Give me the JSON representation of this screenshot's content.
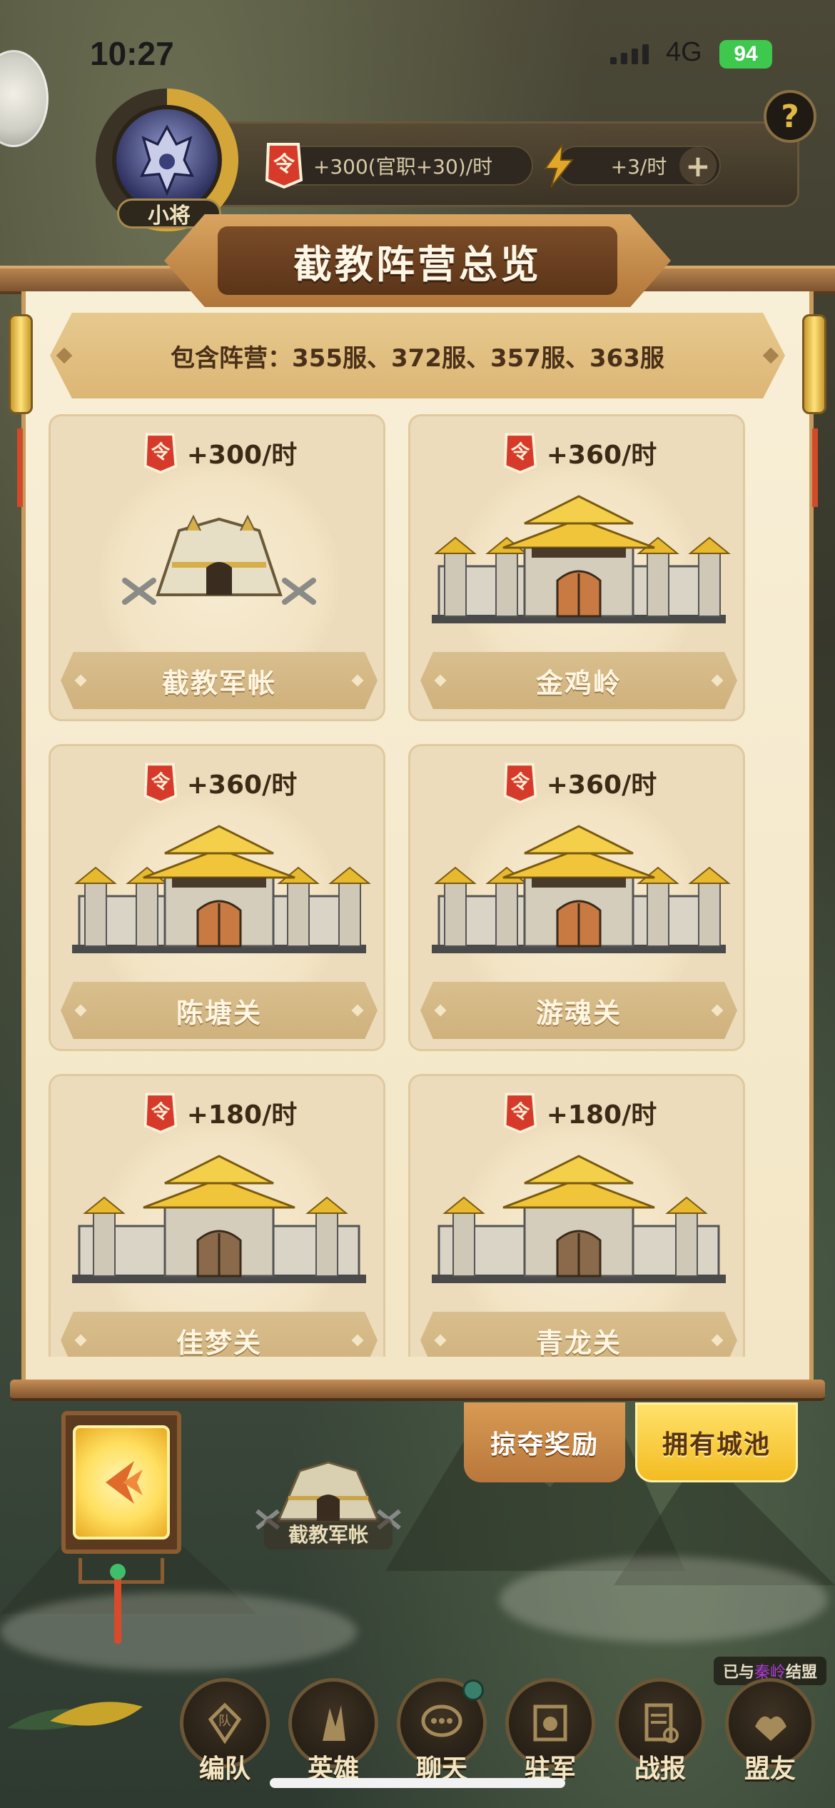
{
  "status_bar": {
    "time": "10:27",
    "network": "4G",
    "battery": "94"
  },
  "hud": {
    "rank": "小将",
    "income_rate": "+300(官职+30)/时",
    "energy_rate": "+3/时",
    "plus": "+",
    "help": "?"
  },
  "panel": {
    "title": "截教阵营总览",
    "factions_label": "包含阵营：355服、372服、357服、363服"
  },
  "cities": [
    {
      "name": "截教军帐",
      "rate": "+300/时",
      "type": "tent"
    },
    {
      "name": "金鸡岭",
      "rate": "+360/时",
      "type": "palace"
    },
    {
      "name": "陈塘关",
      "rate": "+360/时",
      "type": "palace"
    },
    {
      "name": "游魂关",
      "rate": "+360/时",
      "type": "palace"
    },
    {
      "name": "佳梦关",
      "rate": "+180/时",
      "type": "fort"
    },
    {
      "name": "青龙关",
      "rate": "+180/时",
      "type": "fort"
    }
  ],
  "tabs": {
    "loot": "掠夺奖励",
    "own": "拥有城池"
  },
  "map": {
    "tent_label": "截教军帐"
  },
  "alliance": {
    "prefix": "已与",
    "name": "秦岭",
    "suffix": "结盟"
  },
  "nav": [
    {
      "label": "编队",
      "icon": "formation-icon"
    },
    {
      "label": "英雄",
      "icon": "hero-icon"
    },
    {
      "label": "聊天",
      "icon": "chat-icon"
    },
    {
      "label": "驻军",
      "icon": "garrison-icon"
    },
    {
      "label": "战报",
      "icon": "report-icon"
    },
    {
      "label": "盟友",
      "icon": "ally-icon"
    }
  ],
  "colors": {
    "accent_gold": "#f3bc22",
    "paper": "#f8efd7",
    "wood": "#8b5c32"
  }
}
